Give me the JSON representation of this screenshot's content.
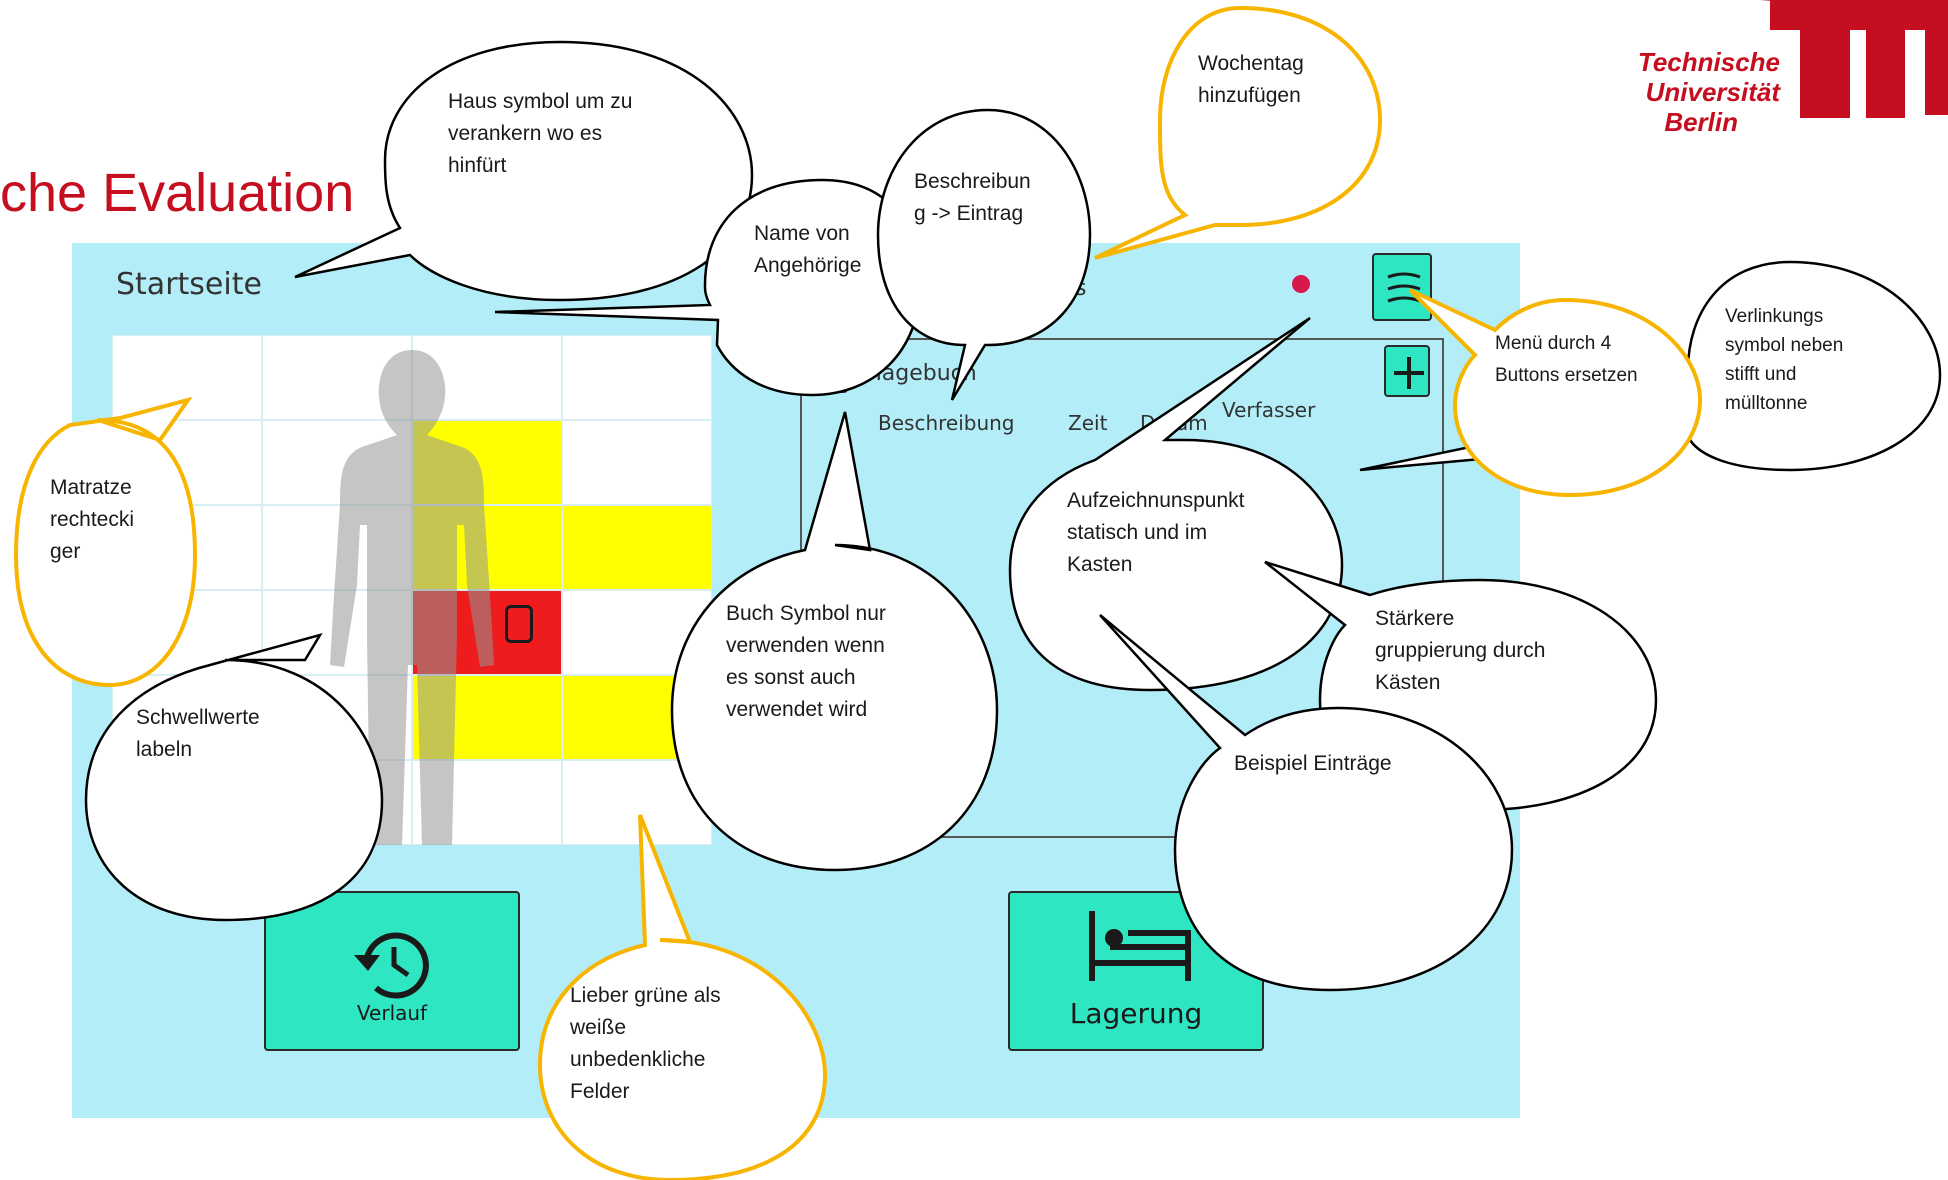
{
  "slide": {
    "title": "che Evaluation",
    "logo_lines": [
      "Technische",
      "Universität",
      "Berlin"
    ]
  },
  "mockup": {
    "page_title": "Startseite",
    "journal_title": "Tagebuch",
    "partial_label": "s",
    "columns": [
      "Beschreibung",
      "Zeit",
      "Datum",
      "Verfasser"
    ],
    "buttons": {
      "history": "Verlauf",
      "positioning": "Lagerung",
      "menu_icon": "hamburger-menu-icon",
      "add_icon": "plus-icon"
    },
    "heatmap": {
      "rows": 6,
      "cols": 4,
      "cells": [
        [
          "white",
          "white",
          "white",
          "white"
        ],
        [
          "white",
          "white",
          "yellow",
          "white"
        ],
        [
          "white",
          "white",
          "yellow",
          "yellow"
        ],
        [
          "white",
          "white",
          "red",
          "white"
        ],
        [
          "white",
          "white",
          "yellow",
          "yellow"
        ],
        [
          "white",
          "white",
          "white",
          "white"
        ]
      ],
      "colors": {
        "white": "#ffffff",
        "yellow": "#ffff00",
        "red": "#ee1c1c"
      }
    },
    "colors": {
      "background": "#b3eef8",
      "accent": "#2fe6c3",
      "status_dot": "#d6194a"
    }
  },
  "bubbles": {
    "home_symbol": "Haus symbol um zu\nverankern wo es\nhinfürt",
    "weekday": "Wochentag\nhinzufügen",
    "description": "Beschreibun\ng -> Eintrag",
    "relative_name": "Name von\nAngehörige",
    "menu": "Menü durch 4\nButtons ersetzen",
    "link_symbol": "Verlinkungs\nsymbol neben\nstifft und\nmülltonne",
    "mattress": "Matratze\nrechtecki\nger",
    "record_point": "Aufzeichnunspunkt\nstatisch und im\nKasten",
    "book_symbol": "Buch Symbol nur\nverwenden wenn\nes sonst auch\nverwendet wird",
    "grouping": "Stärkere\ngruppierung  durch\nKästen",
    "thresholds": "Schwellwerte\nlabeln",
    "example_entries": "Beispiel Einträge",
    "green_fields": "Lieber grüne als\nweiße\nunbedenkliche\nFelder"
  }
}
